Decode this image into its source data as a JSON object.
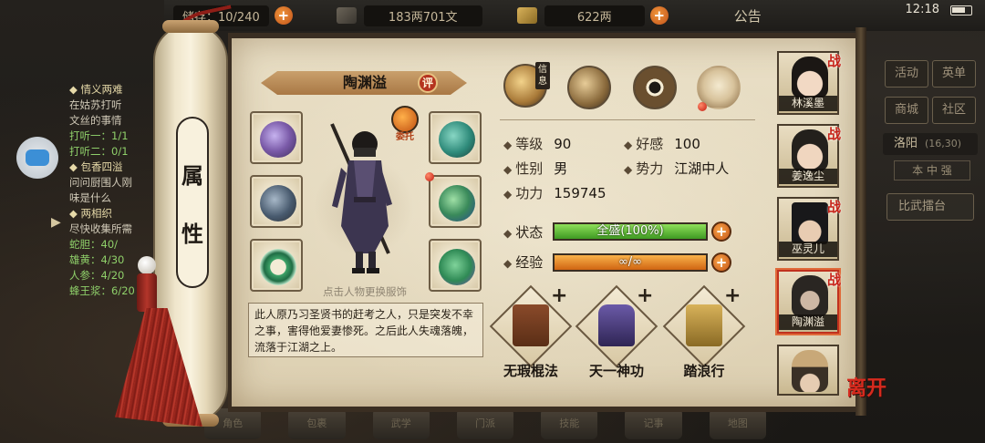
{
  "topbar": {
    "partial_label": "储存：10/240",
    "money": "183两701文",
    "gold": "622两",
    "notice": "公告",
    "clock": "12:18"
  },
  "quest_log": [
    {
      "text": "◆ 情义两难",
      "style": "title"
    },
    {
      "text": "在姑苏打听",
      "style": "normal"
    },
    {
      "text": "文丝的事情",
      "style": "normal"
    },
    {
      "text": "打听一：1/1",
      "style": "green"
    },
    {
      "text": "打听二：0/1",
      "style": "green"
    },
    {
      "text": "◆ 包香四溢",
      "style": "title"
    },
    {
      "text": "问问厨围人刚",
      "style": "normal"
    },
    {
      "text": "味是什么",
      "style": "normal"
    },
    {
      "text": "◆ 两相织",
      "style": "title"
    },
    {
      "text": "尽快收集所需",
      "style": "normal"
    },
    {
      "text": "蛇胆：40/",
      "style": "green"
    },
    {
      "text": "雄黄：4/30",
      "style": "green"
    },
    {
      "text": "人参：4/20",
      "style": "green"
    },
    {
      "text": "蜂王浆：6/20",
      "style": "green"
    }
  ],
  "right_menu": {
    "activity": "活动",
    "shop": "英单",
    "mall": "商城",
    "community": "社区",
    "city": "洛阳",
    "city_coords": "(16,30)",
    "tab": "本 中 强",
    "arena": "比武擂台"
  },
  "bottom_bar": [
    "角色",
    "包裹",
    "武学",
    "门派",
    "技能",
    "记事",
    "地图"
  ],
  "scroll": {
    "roller_chars": [
      "属",
      "性"
    ]
  },
  "character": {
    "name": "陶渊溢",
    "review_badge": "评",
    "commission": "委托",
    "hint": "点击人物更换服饰",
    "description": "此人原乃习圣贤书的赶考之人，只是突发不幸之事，害得他爱妻惨死。之后此人失魂落魄，流落于江湖之上。"
  },
  "categories": {
    "letter_tag": "信息"
  },
  "stats": {
    "level_label": "等级",
    "level": "90",
    "favor_label": "好感",
    "favor": "100",
    "gender_label": "性别",
    "gender": "男",
    "faction_label": "势力",
    "faction": "江湖中人",
    "power_label": "功力",
    "power": "159745",
    "state_label": "状态",
    "state_text": "全盛(100%)",
    "state_fill": 1.0,
    "exp_label": "经验",
    "exp_text": "∞/∞",
    "exp_fill": 1.0
  },
  "skills": [
    {
      "name": "无瑕棍法",
      "plus": "+"
    },
    {
      "name": "天一神功",
      "plus": "+"
    },
    {
      "name": "踏浪行",
      "plus": "+"
    }
  ],
  "companions": [
    {
      "name": "林溪墨",
      "battle": "战"
    },
    {
      "name": "姜逸尘",
      "battle": "战"
    },
    {
      "name": "巫灵儿",
      "battle": "战"
    },
    {
      "name": "陶渊溢",
      "battle": "战"
    },
    {
      "name": "",
      "battle": ""
    }
  ],
  "leave_button": "离开",
  "colors": {
    "accent_orange": "#e07a22",
    "state_green": "#5cc02e",
    "exp_orange": "#e88a2a",
    "battle_red": "#c8241a"
  }
}
